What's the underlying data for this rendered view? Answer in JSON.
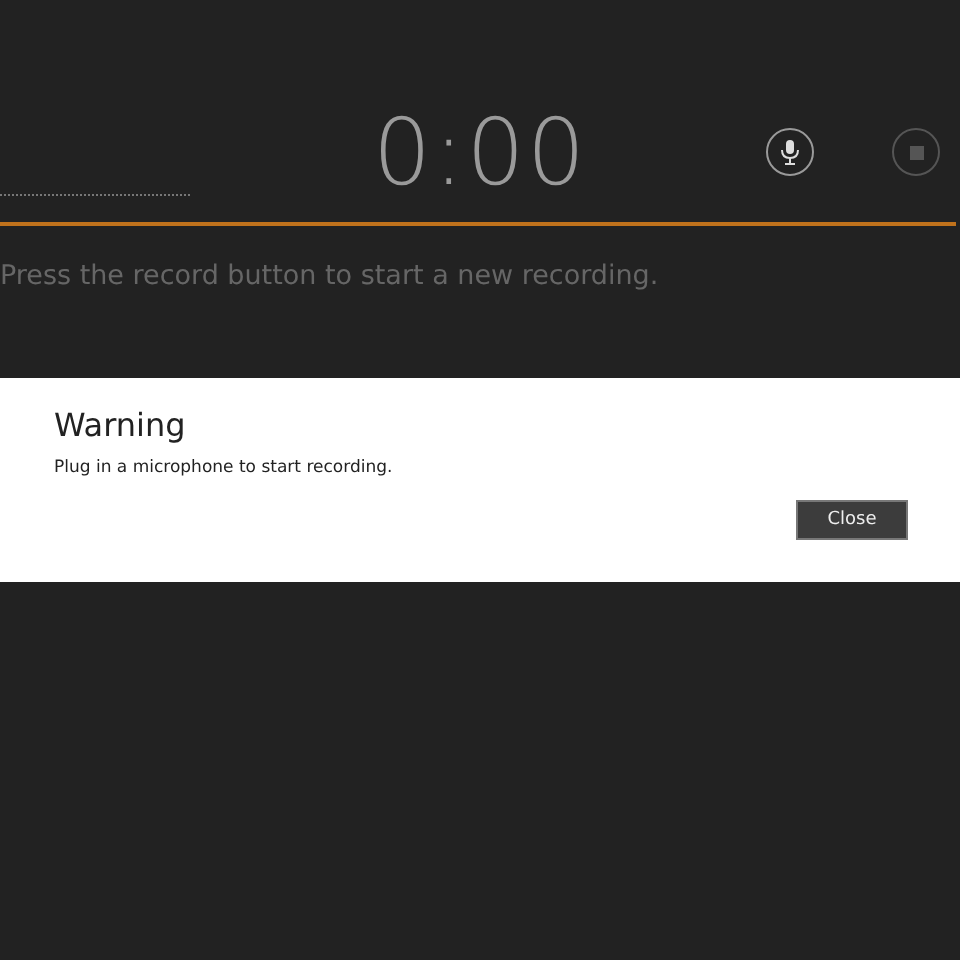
{
  "timer": "0:00",
  "hint": "Press the record button to start a new recording.",
  "dialog": {
    "title": "Warning",
    "message": "Plug in a microphone to start recording.",
    "buttons": [
      "Close"
    ]
  }
}
